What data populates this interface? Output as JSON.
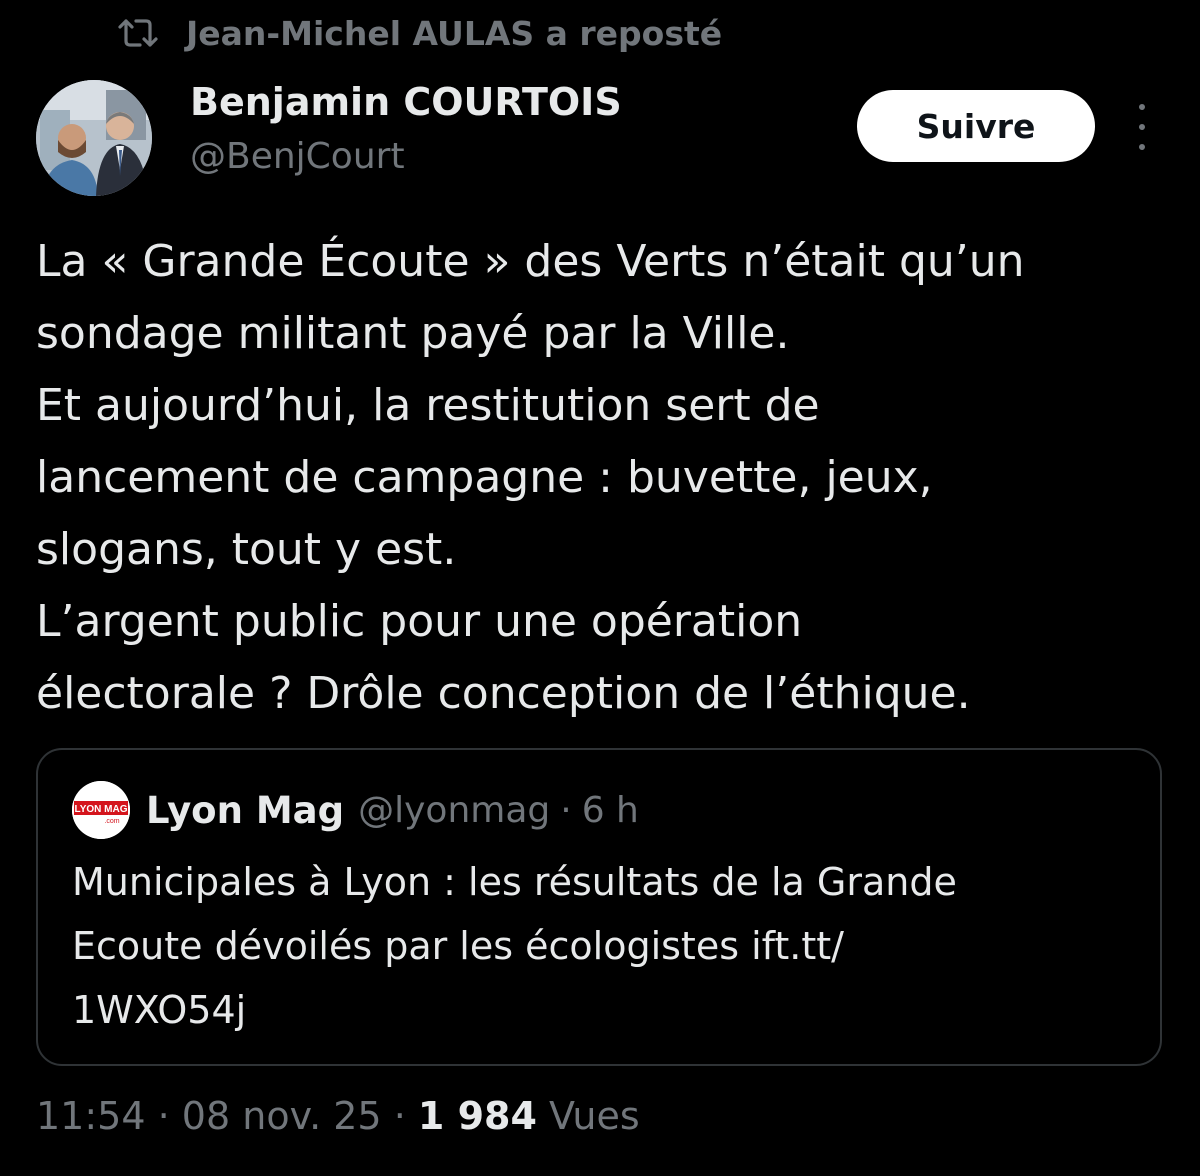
{
  "repost": {
    "icon": "repost-icon",
    "text": "Jean-Michel AULAS a reposté"
  },
  "author": {
    "name": "Benjamin COURTOIS",
    "handle": "@BenjCourt",
    "avatar_icon": "profile-photo"
  },
  "actions": {
    "follow_label": "Suivre",
    "more_icon": "more-vertical-icon"
  },
  "tweet": {
    "lines": [
      "La « Grande Écoute » des Verts n’était qu’un",
      "sondage militant payé par la Ville.",
      "Et aujourd’hui, la restitution sert de",
      "lancement de campagne : buvette, jeux,",
      "slogans, tout y est.",
      "L’argent public pour une opération",
      "électorale ? Drôle conception de l’éthique."
    ]
  },
  "quote": {
    "avatar_text": "LYON MAG",
    "avatar_subtext": ".com",
    "name": "Lyon Mag",
    "handle": "@lyonmag",
    "separator": "·",
    "time": "6 h",
    "lines": [
      "Municipales à Lyon : les résultats de la Grande",
      "Ecoute dévoilés par les écologistes ift.tt/",
      "1WXO54j"
    ]
  },
  "meta": {
    "time": "11:54",
    "separator": "·",
    "date": "08 nov. 25",
    "views_count": "1 984",
    "views_label": "Vues"
  },
  "colors": {
    "background": "#000000",
    "text_primary": "#e7e9ea",
    "text_secondary": "#71767b",
    "border": "#2f3336",
    "button_bg": "#ffffff",
    "lyonmag_red": "#d4141c"
  }
}
